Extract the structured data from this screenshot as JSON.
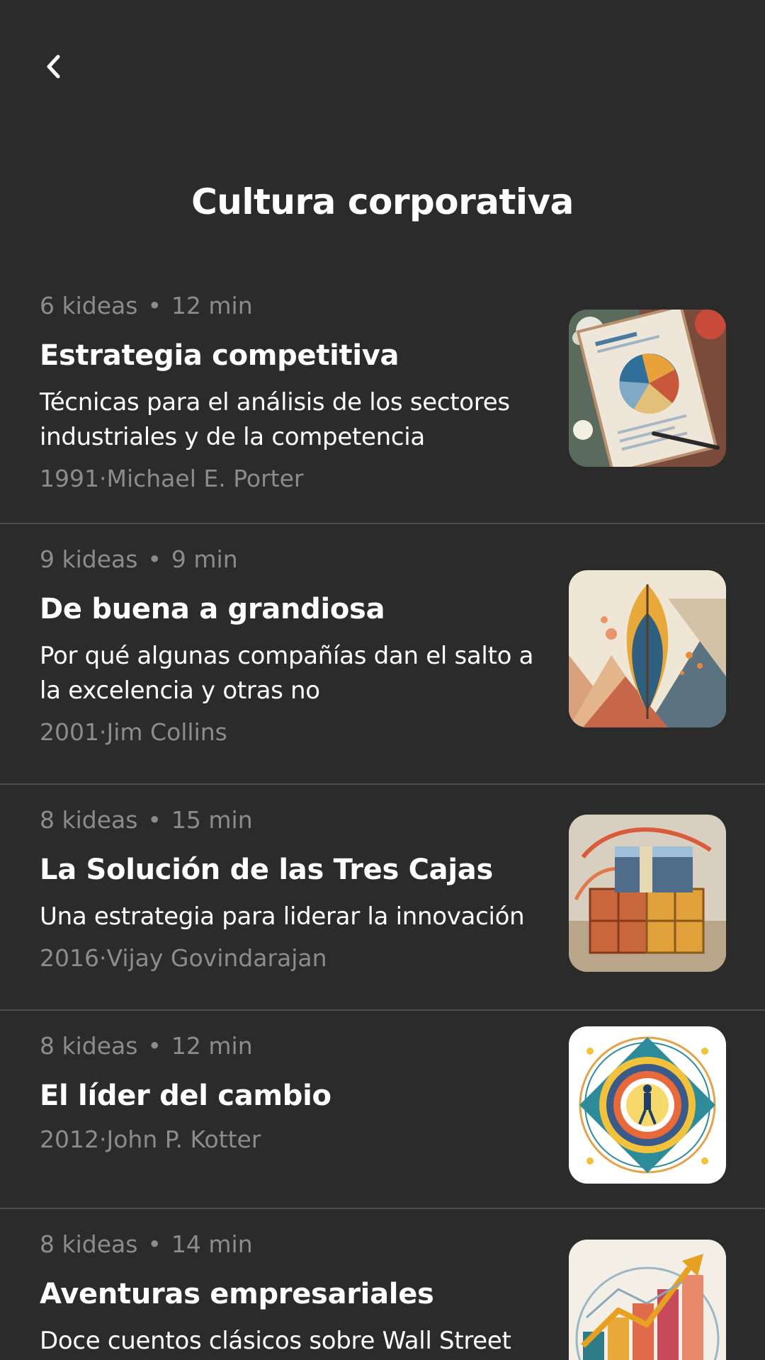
{
  "header": {
    "back_icon": "chevron-left-icon",
    "title": "Cultura corporativa"
  },
  "books": [
    {
      "ideas": "6 kideas",
      "duration": "12 min",
      "title": "Estrategia competitiva",
      "subtitle": "Técnicas para el análisis de los sectores industriales y de la competencia",
      "year": "1991",
      "author": "Michael E. Porter",
      "cover": "pie-chart-document-cover"
    },
    {
      "ideas": "9 kideas",
      "duration": "9 min",
      "title": "De buena a grandiosa",
      "subtitle": "Por qué algunas compañías dan el salto a la excelencia y otras no",
      "year": "2001",
      "author": "Jim Collins",
      "cover": "abstract-leaf-cover"
    },
    {
      "ideas": "8 kideas",
      "duration": "15 min",
      "title": "La Solución de las Tres Cajas",
      "subtitle": "Una estrategia para liderar la innovación",
      "year": "2016",
      "author": "Vijay Govindarajan",
      "cover": "three-boxes-cover"
    },
    {
      "ideas": "8 kideas",
      "duration": "12 min",
      "title": "El líder del cambio",
      "year": "2012",
      "author": "John P. Kotter",
      "cover": "mandala-walking-figure-cover"
    },
    {
      "ideas": "8 kideas",
      "duration": "14 min",
      "title": "Aventuras empresariales",
      "subtitle": "Doce cuentos clásicos sobre Wall Street",
      "cover": "rising-arrow-chart-cover"
    }
  ]
}
